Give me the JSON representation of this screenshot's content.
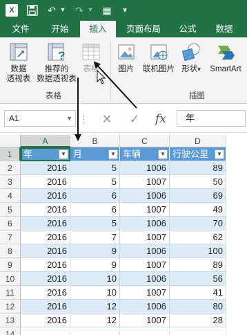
{
  "quick_access": {
    "logo": "X",
    "save": "💾",
    "undo": "↶",
    "undo_dd": "▾",
    "redo": "↷",
    "redo_dd": "▾",
    "grid_icon": "▦",
    "custom_dd": "▾"
  },
  "tabs": [
    "文件",
    "开始",
    "插入",
    "页面布局",
    "公式",
    "数据"
  ],
  "active_tab_index": 2,
  "ribbon": {
    "buttons": [
      {
        "line1": "数据",
        "line2": "透视表",
        "icon": "pivot-table-icon"
      },
      {
        "line1": "推荐的",
        "line2": "数据透视表",
        "icon": "recommended-pivot-icon"
      },
      {
        "line1": "表格",
        "line2": "",
        "icon": "table-icon",
        "disabled": true
      },
      {
        "line1": "图片",
        "line2": "",
        "icon": "picture-icon"
      },
      {
        "line1": "联机图片",
        "line2": "",
        "icon": "online-picture-icon"
      },
      {
        "line1": "形状",
        "line2": "",
        "icon": "shapes-icon",
        "dropdown": "▾"
      },
      {
        "line1": "SmartArt",
        "line2": "",
        "icon": "smartart-icon"
      }
    ],
    "group_labels": [
      "表格",
      "插图"
    ]
  },
  "formula_bar": {
    "name_box": "A1",
    "name_dd": "▼",
    "dots": "⋮",
    "cancel": "✕",
    "enter": "✓",
    "fx": "fx",
    "content": "年"
  },
  "grid": {
    "columns": [
      "A",
      "B",
      "C",
      "D"
    ],
    "selected_column": "A",
    "headers": [
      "年",
      "月",
      "车辆",
      "行驶公里"
    ],
    "filter_glyph": "▼",
    "rows": [
      {
        "n": "2",
        "cells": [
          "2016",
          "5",
          "1006",
          "89"
        ]
      },
      {
        "n": "3",
        "cells": [
          "2016",
          "5",
          "1007",
          "50"
        ]
      },
      {
        "n": "4",
        "cells": [
          "2016",
          "6",
          "1006",
          "69"
        ]
      },
      {
        "n": "5",
        "cells": [
          "2016",
          "6",
          "1007",
          "49"
        ]
      },
      {
        "n": "6",
        "cells": [
          "2016",
          "5",
          "1006",
          "70"
        ]
      },
      {
        "n": "7",
        "cells": [
          "2016",
          "7",
          "1007",
          "62"
        ]
      },
      {
        "n": "8",
        "cells": [
          "2016",
          "9",
          "1006",
          "100"
        ]
      },
      {
        "n": "9",
        "cells": [
          "2016",
          "9",
          "1007",
          "89"
        ]
      },
      {
        "n": "10",
        "cells": [
          "2016",
          "10",
          "1006",
          "56"
        ]
      },
      {
        "n": "11",
        "cells": [
          "2016",
          "10",
          "1007",
          "41"
        ]
      },
      {
        "n": "12",
        "cells": [
          "2016",
          "12",
          "1006",
          "80"
        ]
      },
      {
        "n": "13",
        "cells": [
          "2016",
          "12",
          "1007",
          "28"
        ]
      }
    ],
    "header_row_number": "1",
    "empty_row_number": "14"
  },
  "colors": {
    "excel_green": "#217346",
    "table_header": "#5b9bd5",
    "band": "#ddebf7",
    "arrow": "#111111"
  }
}
